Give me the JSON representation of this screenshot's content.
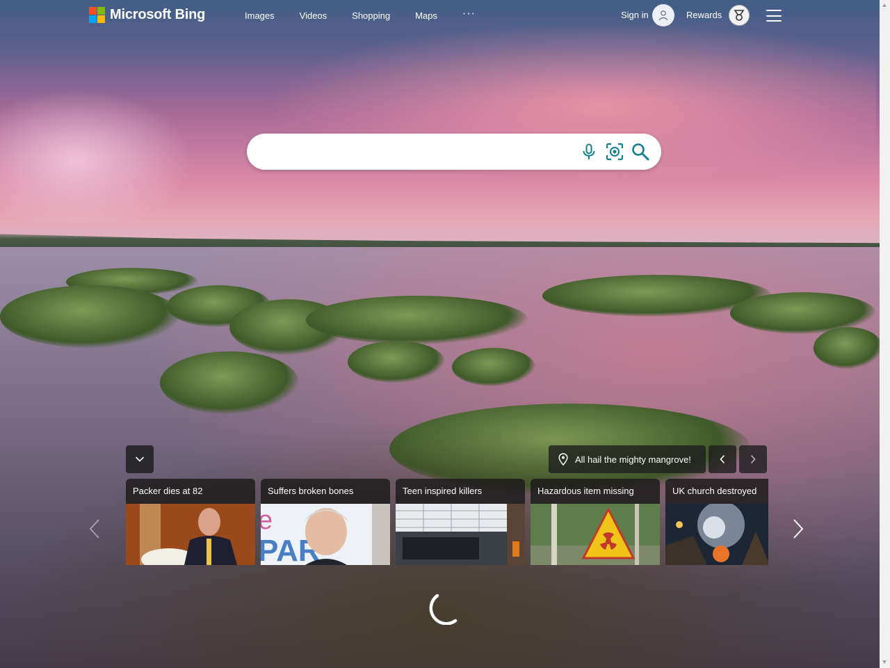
{
  "header": {
    "brand": "Microsoft Bing",
    "nav": [
      {
        "label": "Images"
      },
      {
        "label": "Videos"
      },
      {
        "label": "Shopping"
      },
      {
        "label": "Maps"
      }
    ],
    "more_label": "···",
    "signin_label": "Sign in",
    "rewards_label": "Rewards"
  },
  "search": {
    "value": "",
    "icons": [
      "microphone-icon",
      "visual-search-icon",
      "search-icon"
    ]
  },
  "image_info": {
    "caption": "All hail the mighty mangrove!"
  },
  "news": {
    "cards": [
      {
        "title": "Packer dies at 82"
      },
      {
        "title": "Suffers broken bones"
      },
      {
        "title": "Teen inspired killers"
      },
      {
        "title": "Hazardous item missing"
      },
      {
        "title": "UK church destroyed"
      }
    ]
  },
  "colors": {
    "ms_red": "#f25022",
    "ms_green": "#7fba00",
    "ms_blue": "#00a4ef",
    "ms_yellow": "#ffb900",
    "search_icon_teal": "#137e8e"
  }
}
